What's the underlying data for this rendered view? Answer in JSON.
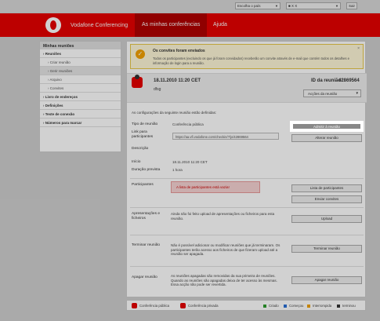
{
  "topbar": {
    "language_select": "Escolha o país",
    "user_select": "X X",
    "sair": "Sair"
  },
  "header": {
    "brand": "Vodafone Conferencing",
    "tabs": [
      {
        "label": "As minhas conferências",
        "active": true
      },
      {
        "label": "Ajuda",
        "active": false
      }
    ],
    "accent_color": "#e60000"
  },
  "sidebar": {
    "title": "Minhas reuniões",
    "items": [
      {
        "label": "› Reuniões",
        "type": "bold"
      },
      {
        "label": "› Criar reunião",
        "type": "sub"
      },
      {
        "label": "› Gerir reuniões",
        "type": "sub-selected"
      },
      {
        "label": "› Arquivo",
        "type": "sub"
      },
      {
        "label": "› Convites",
        "type": "sub"
      },
      {
        "label": "› Livro de endereços",
        "type": "bold"
      },
      {
        "label": "› Definições",
        "type": "bold"
      },
      {
        "label": "› Teste de conexão",
        "type": "bold"
      },
      {
        "label": "› Números para marcar",
        "type": "bold"
      }
    ]
  },
  "notice": {
    "title": "Os convites foram enviados",
    "text": "Todos os participantes (excluindo os que já foram convidados) receberão um convite através de e-mail que contém todos os detalhes e informação de login para a reunião.",
    "close": "×"
  },
  "meeting": {
    "date": "18.11.2010 11:20 CET",
    "name": "dfsg",
    "id_label": "ID da reunião:",
    "id": "42869564",
    "actions": "Acções da reunião"
  },
  "settings_note": "As configurações da seguinte reunião estão definidas:",
  "details": {
    "tipo_label": "Tipo de reunião",
    "tipo_value": "Conferência pública",
    "link_label": "Link para participantes",
    "link_value": "https://aa.vfi.vodafone.com/checkin/?/jx/42869564",
    "descricao_label": "Descrição",
    "inicio_label": "Início",
    "inicio_value": "18.11.2010 11:20 CET",
    "duracao_label": "Duração prevista",
    "duracao_value": "1 hora"
  },
  "buttons": {
    "admit": "Admitir à reunião",
    "alterar": "Alterar reunião",
    "lista": "Lista de participantes",
    "enviar": "Enviar convites",
    "upload": "Upload",
    "terminar": "Terminar reunião",
    "apagar": "Apagar reunião"
  },
  "participants": {
    "label": "Participantes",
    "error": "A lista de participantes está vazia!"
  },
  "sections": {
    "apresentacoes_label": "Apresentações e ficheiros",
    "apresentacoes_text": "Ainda não foi feito upload de apresentações ou ficheiros para esta reunião.",
    "terminar_label": "Terminar reunião",
    "terminar_text": "Não é possível adicionar ou modificar reuniões que já terminaram. Os participantes terão acesso aos ficheiros de que fizeram upload até a reunião ser apagada.",
    "apagar_label": "Apagar reunião",
    "apagar_text": "As reuniões apagadas são removidas da sua primeira de reuniões. Quando as reuniões são apagadas deixa de ter acesso às mesmas. Essa acção não pode ser revertida."
  },
  "legend": {
    "items": [
      {
        "label": "Conferência pública",
        "icon": "public-conference-icon"
      },
      {
        "label": "Conferência privada",
        "icon": "private-conference-icon"
      },
      {
        "label": "Criado",
        "color": "#2e9e2e"
      },
      {
        "label": "Começou",
        "color": "#2a6fd6"
      },
      {
        "label": "Interrompida",
        "color": "#f0a000"
      },
      {
        "label": "terminou",
        "color": "#333333"
      }
    ]
  }
}
